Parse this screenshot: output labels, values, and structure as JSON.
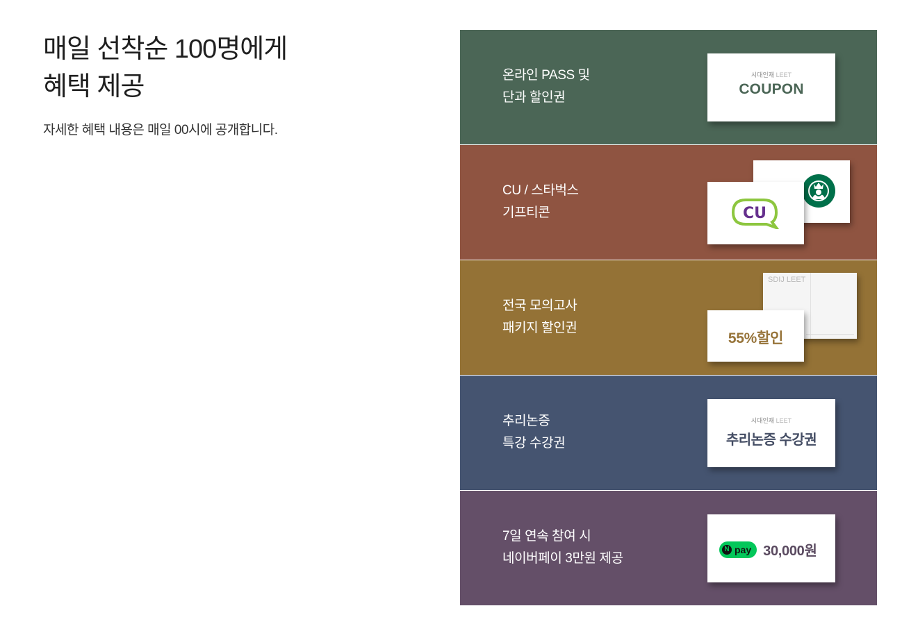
{
  "intro": {
    "headline_line1": "매일 선착순 100명에게",
    "headline_line2": "혜택 제공",
    "subtitle": "자세한 혜택 내용은 매일 00시에 공개합니다."
  },
  "panels": [
    {
      "bg": "#4b6656",
      "label_line1": "온라인 PASS 및",
      "label_line2": "단과 할인권",
      "card_brand": "시대인재",
      "card_brand_accent": "LEET",
      "card_title": "COUPON",
      "card_title_color": "#4b6656"
    },
    {
      "bg": "#8f5441",
      "label_line1": "CU / 스타벅스",
      "label_line2": "기프티콘",
      "cu_logo_text": "CU",
      "cu_purple": "#652f8d",
      "cu_green": "#8dc63f",
      "starbucks_green": "#00704a"
    },
    {
      "bg": "#947236",
      "label_line1": "전국 모의고사",
      "label_line2": "패키지 할인권",
      "mock_brand": "SDIJ LEET",
      "discount": "55%할인"
    },
    {
      "bg": "#455470",
      "label_line1": "추리논증",
      "label_line2": "특강 수강권",
      "card_brand": "시대인재",
      "card_brand_accent": "LEET",
      "card_title": "추리논증 수강권"
    },
    {
      "bg": "#644f68",
      "label_line1": "7일 연속 참여 시",
      "label_line2": "네이버페이 3만원 제공",
      "npay_n": "N",
      "npay_label": "pay",
      "npay_amount": "30,000원"
    }
  ]
}
